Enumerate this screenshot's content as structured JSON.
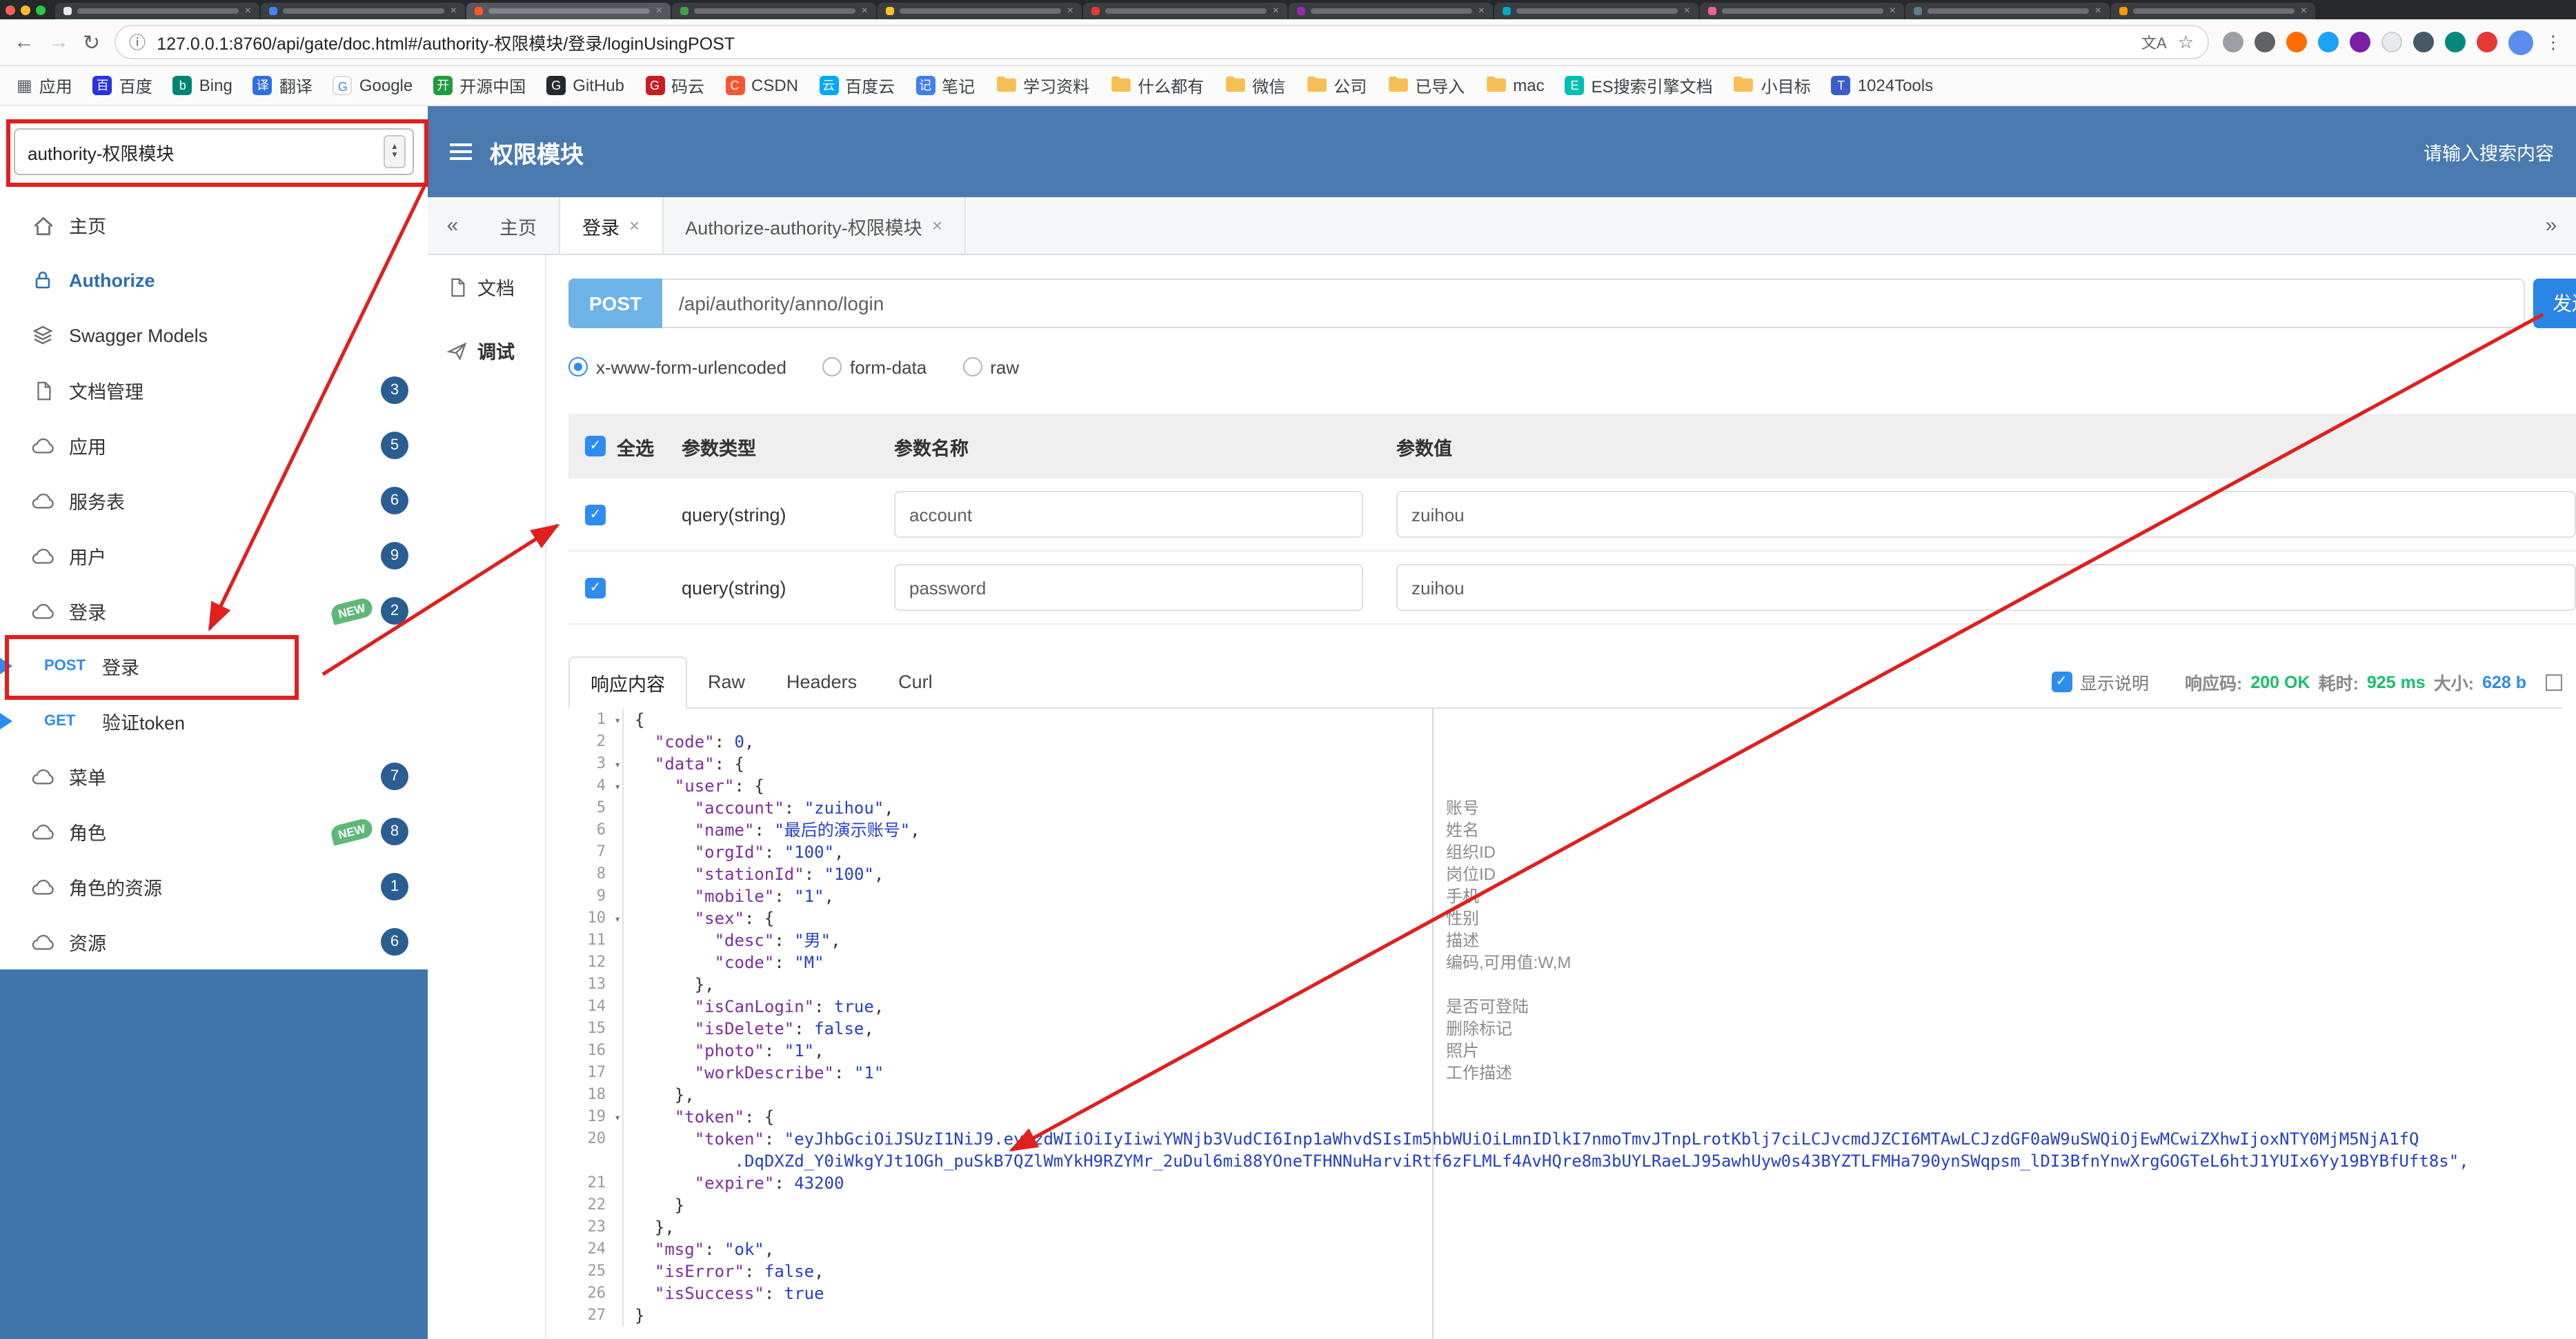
{
  "colors": {
    "header_blue": "#4a7ab0",
    "accent_blue": "#2d8cf0",
    "post_badge_blue": "#6db3e8",
    "send_button_blue": "#2b85e4",
    "badge_circle_blue": "#2a5d92",
    "new_tag_green": "#5fb878",
    "success_green": "#19be6b",
    "size_blue": "#2d8cf0",
    "annotation_red": "#e01f1f"
  },
  "browser": {
    "url": "127.0.0.1:8760/api/gate/doc.html#/authority-权限模块/登录/loginUsingPOST",
    "bookmarks": [
      {
        "label": "应用",
        "icon": "apps"
      },
      {
        "label": "百度",
        "icon": "baidu"
      },
      {
        "label": "Bing",
        "icon": "bing"
      },
      {
        "label": "翻译",
        "icon": "translate"
      },
      {
        "label": "Google",
        "icon": "google"
      },
      {
        "label": "开源中国",
        "icon": "osc"
      },
      {
        "label": "GitHub",
        "icon": "github"
      },
      {
        "label": "码云",
        "icon": "gitee"
      },
      {
        "label": "CSDN",
        "icon": "csdn"
      },
      {
        "label": "百度云",
        "icon": "baidu-cloud"
      },
      {
        "label": "笔记",
        "icon": "note"
      },
      {
        "label": "学习资料",
        "icon": "folder"
      },
      {
        "label": "什么都有",
        "icon": "folder"
      },
      {
        "label": "微信",
        "icon": "folder"
      },
      {
        "label": "公司",
        "icon": "folder"
      },
      {
        "label": "已导入",
        "icon": "folder"
      },
      {
        "label": "mac",
        "icon": "folder"
      },
      {
        "label": "ES搜索引擎文档",
        "icon": "es"
      },
      {
        "label": "小目标",
        "icon": "folder"
      },
      {
        "label": "1024Tools",
        "icon": "tools"
      }
    ]
  },
  "header": {
    "module_select": "authority-权限模块",
    "title": "权限模块",
    "search_placeholder": "请输入搜索内容"
  },
  "sidebar": {
    "new_label": "NEW",
    "items": [
      {
        "label": "主页",
        "icon": "home"
      },
      {
        "label": "Authorize",
        "icon": "lock",
        "highlight": true
      },
      {
        "label": "Swagger Models",
        "icon": "models"
      },
      {
        "label": "文档管理",
        "icon": "doc",
        "badge": "3"
      },
      {
        "label": "应用",
        "icon": "cloud",
        "badge": "5"
      },
      {
        "label": "服务表",
        "icon": "cloud",
        "badge": "6"
      },
      {
        "label": "用户",
        "icon": "cloud",
        "badge": "9"
      },
      {
        "label": "登录",
        "icon": "cloud",
        "badge": "2",
        "new": true
      },
      {
        "label": "登录",
        "method": "POST",
        "sub": true,
        "flag": true
      },
      {
        "label": "验证token",
        "method": "GET",
        "sub": true,
        "flag": true
      },
      {
        "label": "菜单",
        "icon": "cloud",
        "badge": "7"
      },
      {
        "label": "角色",
        "icon": "cloud",
        "badge": "8",
        "new": true
      },
      {
        "label": "角色的资源",
        "icon": "cloud",
        "badge": "1"
      },
      {
        "label": "资源",
        "icon": "cloud",
        "badge": "6"
      }
    ]
  },
  "tabbar": {
    "collapse": "«",
    "expand": "»",
    "tabs": [
      {
        "label": "主页",
        "closable": false,
        "active": false
      },
      {
        "label": "登录",
        "closable": true,
        "active": true
      },
      {
        "label": "Authorize-authority-权限模块",
        "closable": true,
        "active": false
      }
    ]
  },
  "doc_tabs": [
    {
      "label": "文档",
      "active": false
    },
    {
      "label": "调试",
      "active": true
    }
  ],
  "request": {
    "method": "POST",
    "url": "/api/authority/anno/login",
    "send_label": "发送",
    "body_types": [
      {
        "label": "x-www-form-urlencoded",
        "selected": true
      },
      {
        "label": "form-data",
        "selected": false
      },
      {
        "label": "raw",
        "selected": false
      }
    ],
    "params": {
      "header": {
        "select_all": "全选",
        "type": "参数类型",
        "name": "参数名称",
        "value": "参数值"
      },
      "rows": [
        {
          "checked": true,
          "type": "query(string)",
          "name": "account",
          "value": "zuihou"
        },
        {
          "checked": true,
          "type": "query(string)",
          "name": "password",
          "value": "zuihou"
        }
      ]
    }
  },
  "response": {
    "tabs": [
      {
        "label": "响应内容",
        "active": true
      },
      {
        "label": "Raw",
        "active": false
      },
      {
        "label": "Headers",
        "active": false
      },
      {
        "label": "Curl",
        "active": false
      }
    ],
    "show_desc_label": "显示说明",
    "status": {
      "code_label": "响应码:",
      "code_value": "200 OK",
      "time_label": "耗时:",
      "time_value": "925 ms",
      "size_label": "大小:",
      "size_value": "628 b"
    },
    "code_lines": [
      [
        "1",
        "{"
      ],
      [
        "2",
        "  \"code\": 0,"
      ],
      [
        "3",
        "  \"data\": {"
      ],
      [
        "4",
        "    \"user\": {"
      ],
      [
        "5",
        "      \"account\": \"zuihou\","
      ],
      [
        "6",
        "      \"name\": \"最后的演示账号\","
      ],
      [
        "7",
        "      \"orgId\": \"100\","
      ],
      [
        "8",
        "      \"stationId\": \"100\","
      ],
      [
        "9",
        "      \"mobile\": \"1\","
      ],
      [
        "10",
        "      \"sex\": {"
      ],
      [
        "11",
        "        \"desc\": \"男\","
      ],
      [
        "12",
        "        \"code\": \"M\""
      ],
      [
        "13",
        "      },"
      ],
      [
        "14",
        "      \"isCanLogin\": true,"
      ],
      [
        "15",
        "      \"isDelete\": false,"
      ],
      [
        "16",
        "      \"photo\": \"1\","
      ],
      [
        "17",
        "      \"workDescribe\": \"1\""
      ],
      [
        "18",
        "    },"
      ],
      [
        "19",
        "    \"token\": {"
      ],
      [
        "20",
        "      \"token\": \"eyJhbGciOiJSUzI1NiJ9.eyJzdWIiOiIyIiwiYWNjb3VudCI6Inp1aWhvdSIsIm5hbWUiOiLmnIDlkI7nmoTmvJTnpLrotKblj7ciLCJvcmdJZCI6MTAwLCJzdGF0aW9uSWQiOjEwMCwiZXhwIjoxNTY0MjM5NjA1fQ"
      ],
      [
        "",
        "          .DqDXZd_Y0iWkgYJt1OGh_puSkB7QZlWmYkH9RZYMr_2uDul6mi88YOneTFHNNuHarviRtf6zFLMLf4AvHQre8m3bUYLRaeLJ95awhUyw0s43BYZTLFMHa790ynSWqpsm_lDI3BfnYnwXrgGOGTeL6htJ1YUIx6Yy19BYBfUft8s\","
      ],
      [
        "21",
        "      \"expire\": 43200"
      ],
      [
        "22",
        "    }"
      ],
      [
        "23",
        "  },"
      ],
      [
        "24",
        "  \"msg\": \"ok\","
      ],
      [
        "25",
        "  \"isError\": false,"
      ],
      [
        "26",
        "  \"isSuccess\": true"
      ],
      [
        "27",
        "}"
      ]
    ],
    "annotations": {
      "5": "账号",
      "6": "姓名",
      "7": "组织ID",
      "8": "岗位ID",
      "9": "手机",
      "10": "性别",
      "11": "描述",
      "12": "编码,可用值:W,M",
      "14": "是否可登陆",
      "15": "删除标记",
      "16": "照片",
      "17": "工作描述"
    }
  }
}
